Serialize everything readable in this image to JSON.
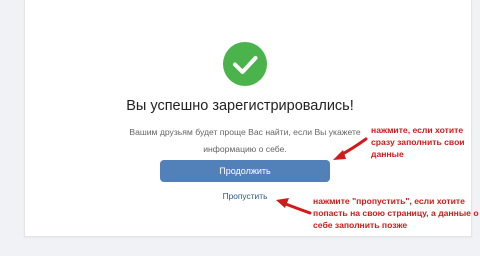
{
  "dialog": {
    "title": "Вы успешно зарегистрировались!",
    "subtitle": "Вашим друзьям будет проще Вас найти, если Вы укажете информацию о себе.",
    "continue_label": "Продолжить",
    "skip_label": "Пропустить"
  },
  "annotations": {
    "continue_note": "нажмите, если хотите сразу заполнить свои данные",
    "skip_note": "нажмите \"пропустить\", если хотите попасть на свою страницу, а данные о себе заполнить позже"
  },
  "icons": {
    "success": "check-icon",
    "arrow": "arrow-left-icon"
  },
  "colors": {
    "success_green": "#4bb34b",
    "button_blue": "#5181b8",
    "link_blue": "#2a5885",
    "annotation_red": "#d11a1a"
  }
}
